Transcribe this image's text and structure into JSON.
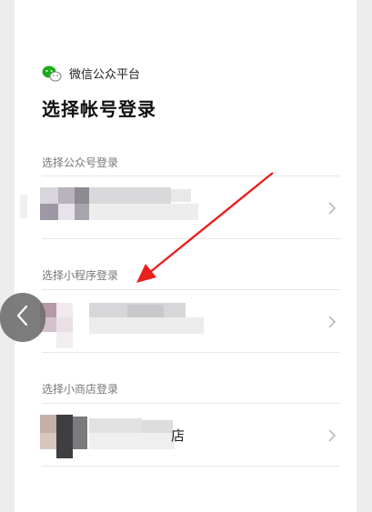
{
  "header": {
    "brand_name": "微信公众平台",
    "title": "选择帐号登录"
  },
  "sections": [
    {
      "label": "选择公众号登录"
    },
    {
      "label": "选择小程序登录"
    },
    {
      "label": "选择小商店登录",
      "visible_suffix": "店"
    }
  ],
  "icons": {
    "brand": "wechat-logo",
    "row_action": "chevron-right-icon",
    "nav": "back-arrow-icon",
    "annotation": "red-arrow"
  },
  "colors": {
    "accent_green": "#1aad19",
    "annotation_red": "#e8211f"
  }
}
